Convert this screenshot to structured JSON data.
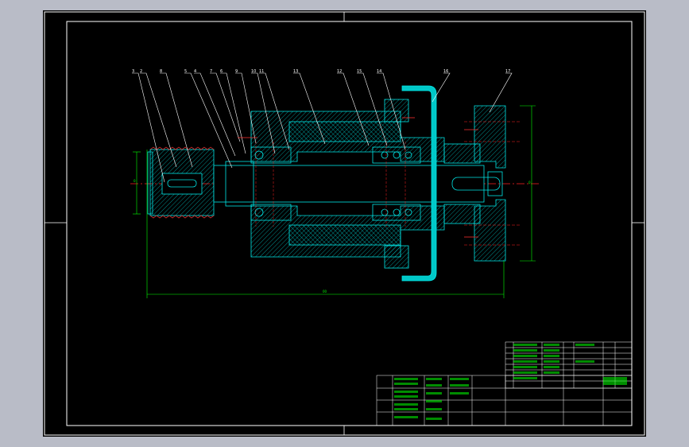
{
  "drawing": {
    "background": "#000000",
    "frame_color": "#ffffff",
    "part_color": "#00e5e5",
    "dimension_color": "#00ff00",
    "centerline_color": "#ff2020",
    "hatch_color": "#00c8c8",
    "callout_color": "#ffffff",
    "leader_labels": [
      "3",
      "2",
      "8",
      "5",
      "4",
      "7",
      "6",
      "9",
      "10",
      "11",
      "13",
      "12",
      "15",
      "14",
      "16"
    ]
  },
  "title_block": {
    "project_title": "",
    "drawing_name": "",
    "drawing_number": ""
  }
}
